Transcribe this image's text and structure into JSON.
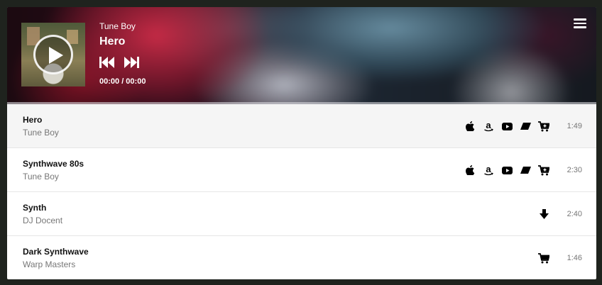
{
  "now_playing": {
    "artist": "Tune Boy",
    "title": "Hero",
    "time": "00:00 / 00:00"
  },
  "icons": {
    "play": "play-icon",
    "previous": "skip-previous-icon",
    "next": "skip-next-icon",
    "menu": "hamburger-menu-icon",
    "apple": "apple-icon",
    "amazon": "amazon-icon",
    "youtube": "youtube-icon",
    "beatport": "beatport-icon",
    "cart": "cart-icon",
    "download": "download-icon"
  },
  "tracks": [
    {
      "title": "Hero",
      "artist": "Tune Boy",
      "duration": "1:49",
      "actions": [
        "apple",
        "amazon",
        "youtube",
        "beatport",
        "cart"
      ]
    },
    {
      "title": "Synthwave 80s",
      "artist": "Tune Boy",
      "duration": "2:30",
      "actions": [
        "apple",
        "amazon",
        "youtube",
        "beatport",
        "cart"
      ]
    },
    {
      "title": "Synth",
      "artist": "DJ Docent",
      "duration": "2:40",
      "actions": [
        "download"
      ]
    },
    {
      "title": "Dark Synthwave",
      "artist": "Warp Masters",
      "duration": "1:46",
      "actions": [
        "cart"
      ]
    }
  ],
  "colors": {
    "page_bg": "#1f231e",
    "active_row": "#f5f5f5",
    "title_text": "#111111",
    "secondary_text": "#777777"
  }
}
